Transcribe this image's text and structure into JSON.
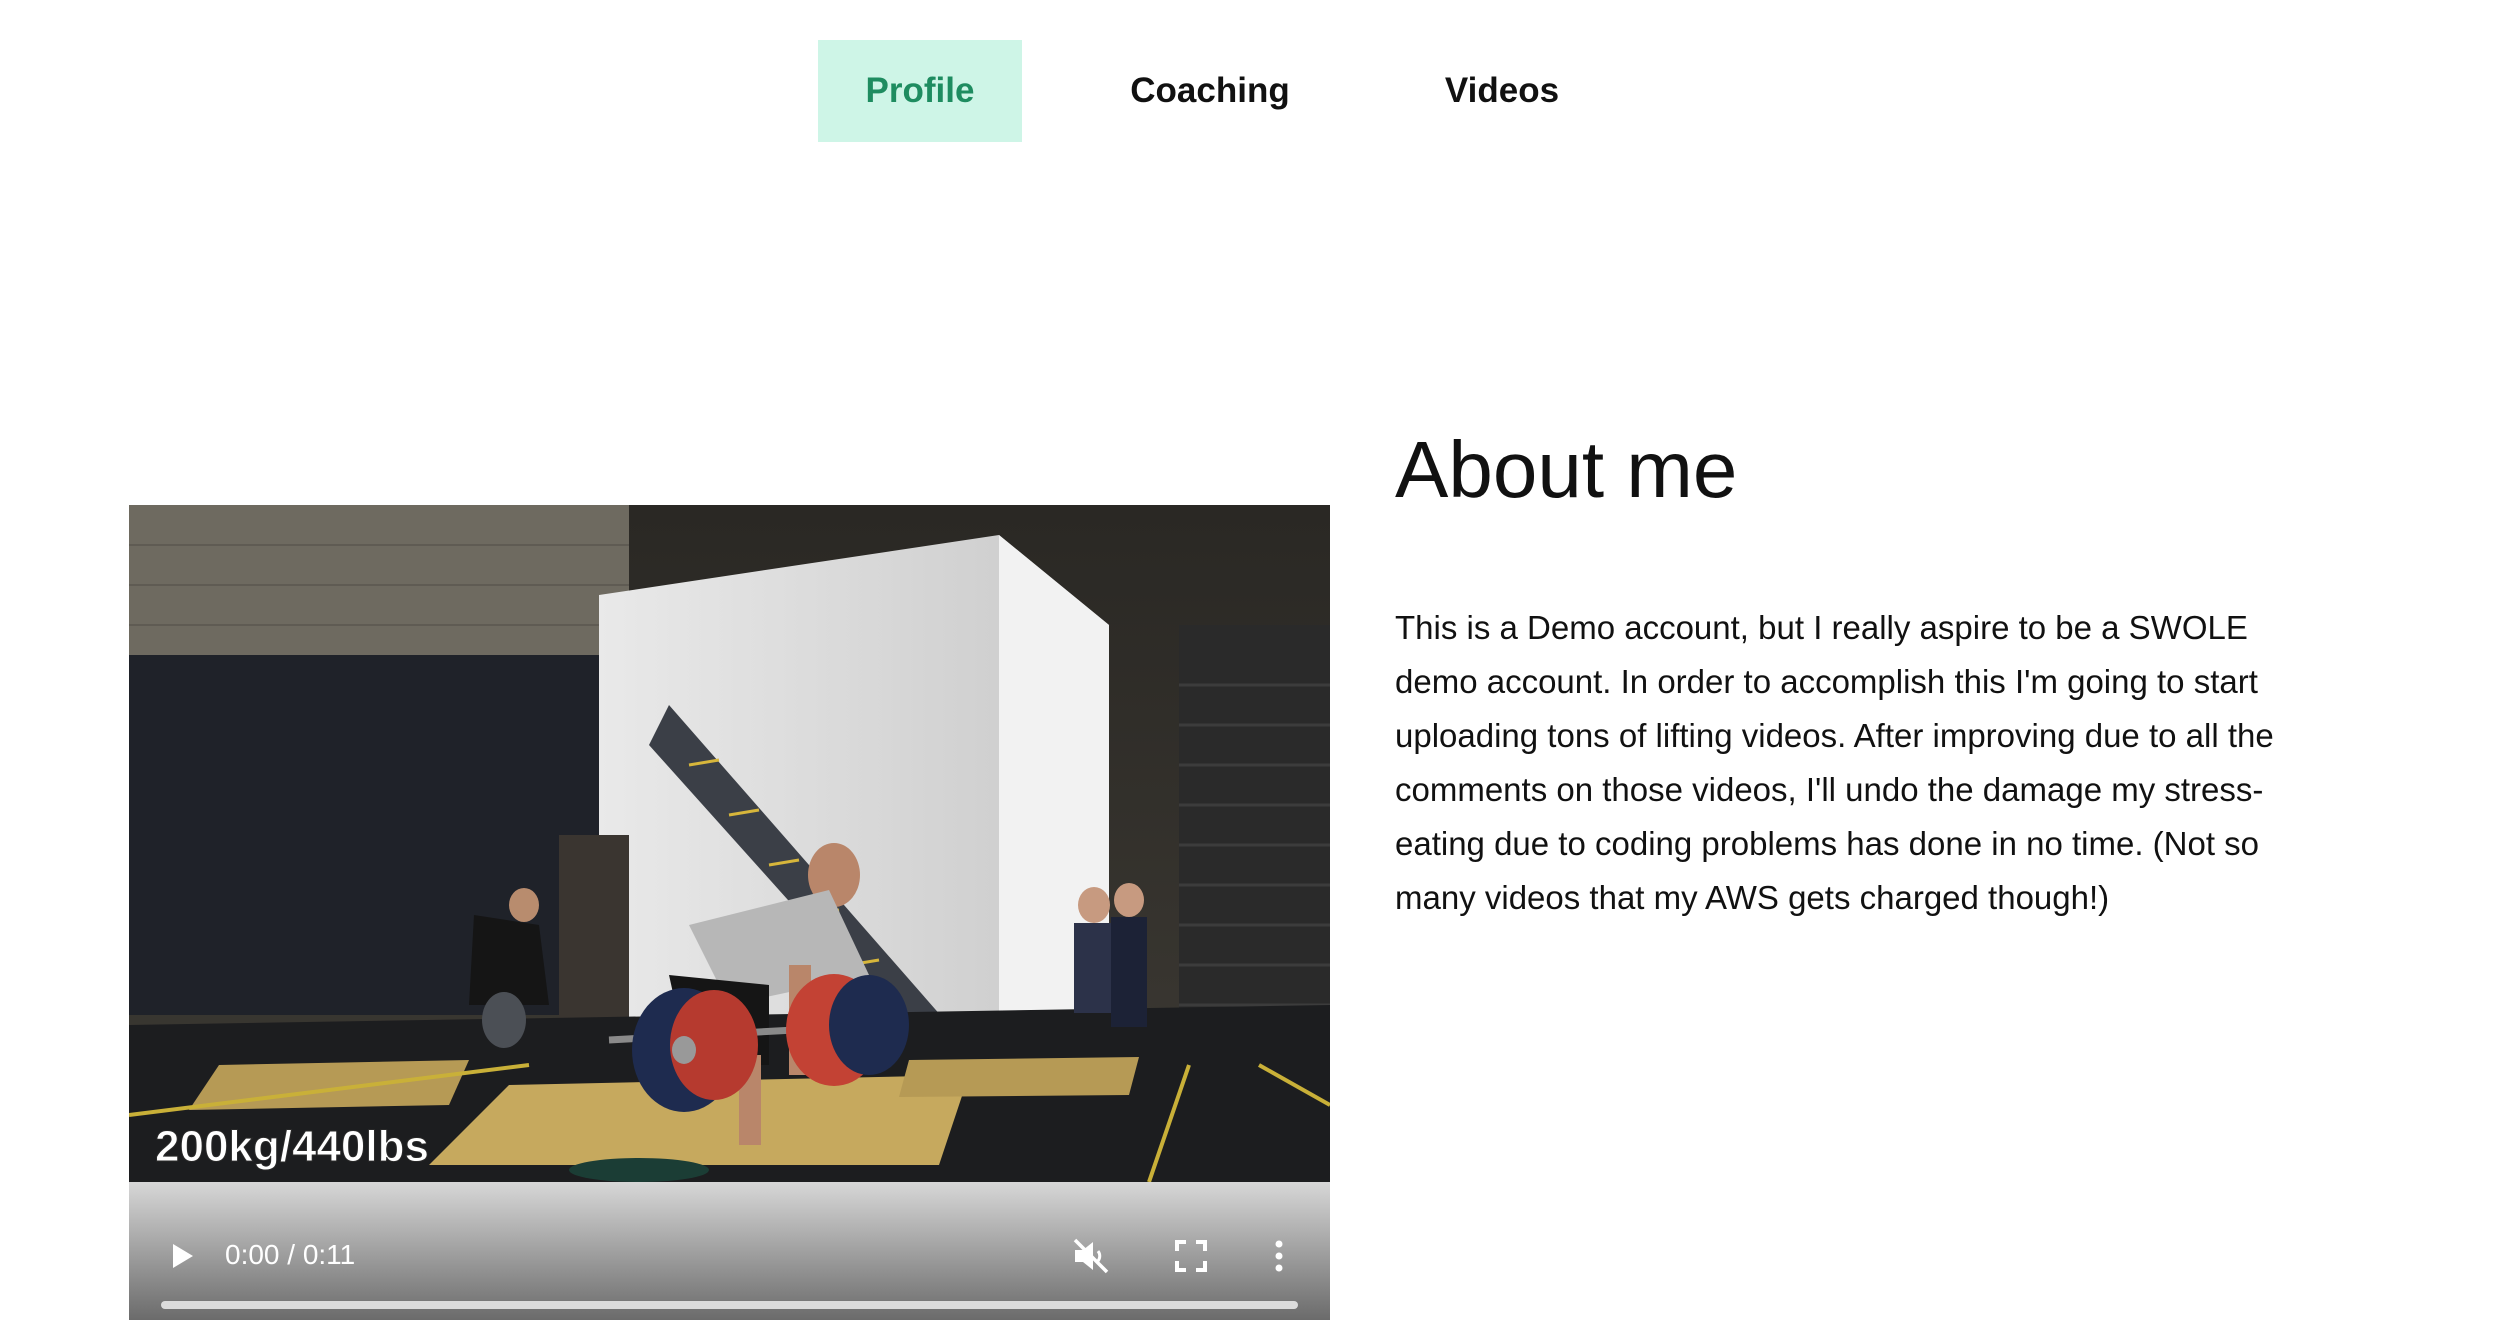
{
  "nav": {
    "tabs": [
      {
        "label": "Profile",
        "active": true
      },
      {
        "label": "Coaching",
        "active": false
      },
      {
        "label": "Videos",
        "active": false
      }
    ],
    "active_bg": "#cef5e7",
    "active_color": "#1e8c60"
  },
  "video": {
    "overlay_text": "200kg/440lbs",
    "time_display": "0:00 / 0:11",
    "progress": 0,
    "muted": true,
    "icons": [
      "play-icon",
      "muted-volume-icon",
      "fullscreen-icon",
      "more-options-icon"
    ]
  },
  "about": {
    "title": "About me",
    "body": "This is a Demo account, but I really aspire to be a SWOLE demo account. In order to accomplish this I'm going to start uploading tons of lifting videos. After improving due to all the comments on those videos, I'll undo the damage my stress-eating due to coding problems has done in no time. (Not so many videos that my AWS gets charged though!)"
  }
}
